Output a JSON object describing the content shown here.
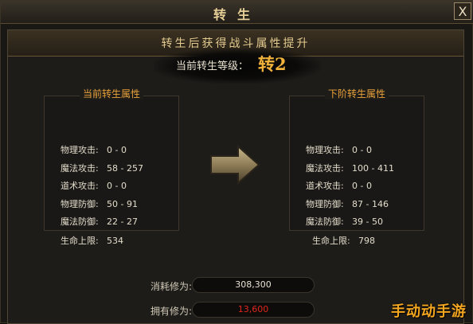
{
  "window": {
    "title": "转生",
    "close_label": "X"
  },
  "banner": {
    "text": "转生后获得战斗属性提升"
  },
  "current": {
    "label": "当前转生等级：",
    "value": "转2"
  },
  "left_panel": {
    "title": "当前转生属性",
    "rows": [
      {
        "name": "物理攻击:",
        "value": "0 - 0"
      },
      {
        "name": "魔法攻击:",
        "value": "58 - 257"
      },
      {
        "name": "道术攻击:",
        "value": "0 - 0"
      },
      {
        "name": "物理防御:",
        "value": "50 - 91"
      },
      {
        "name": "魔法防御:",
        "value": "22 - 27"
      },
      {
        "name": "生命上限:",
        "value": "534"
      }
    ]
  },
  "right_panel": {
    "title": "下阶转生属性",
    "rows": [
      {
        "name": "物理攻击:",
        "value": "0 - 0"
      },
      {
        "name": "魔法攻击:",
        "value": "100 - 411"
      },
      {
        "name": "道术攻击:",
        "value": "0 - 0"
      },
      {
        "name": "物理防御:",
        "value": "87 - 146"
      },
      {
        "name": "魔法防御:",
        "value": "39 - 50"
      },
      {
        "name": "生命上限:",
        "value": "798"
      }
    ]
  },
  "costs": {
    "consume_label": "消耗修为:",
    "consume_value": "308,300",
    "owned_label": "拥有修为:",
    "owned_value": "13,600"
  },
  "colors": {
    "accent": "#f0b23a",
    "insufficient": "#e0251b"
  },
  "watermark": {
    "text": "手动动手游"
  },
  "icons": {
    "next_arrow": "arrow-right-icon"
  }
}
